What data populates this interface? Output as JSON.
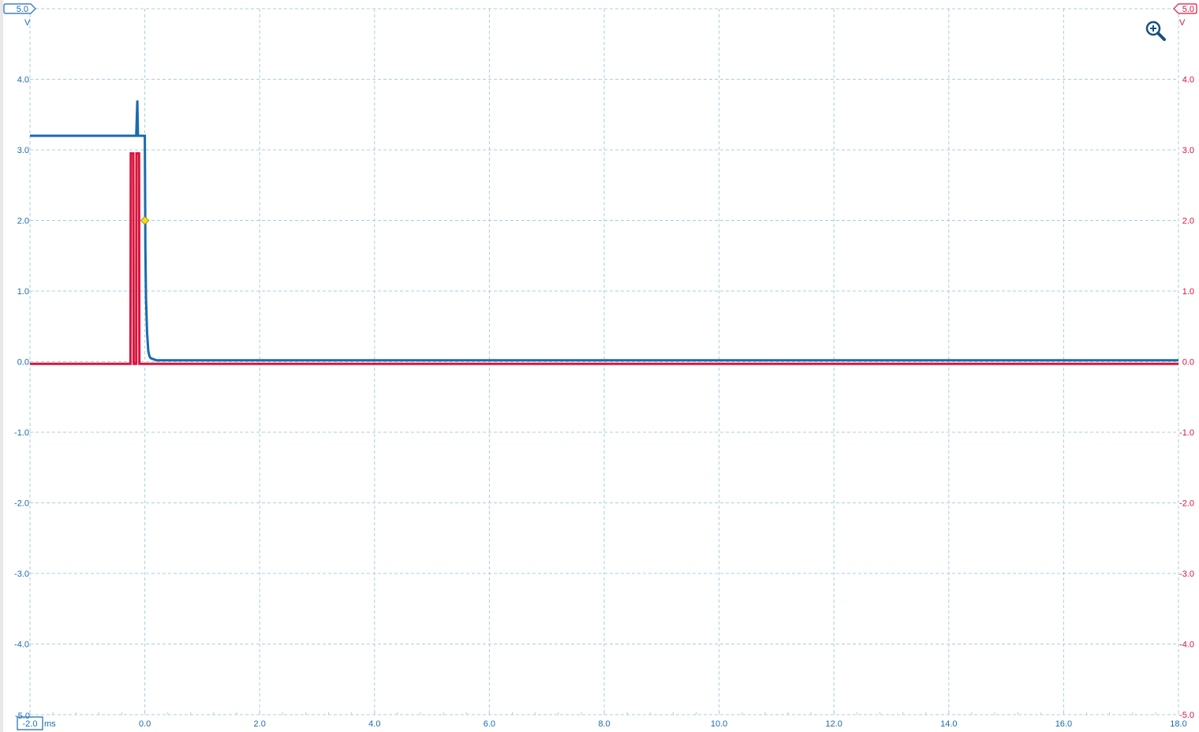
{
  "chart_data": {
    "type": "line",
    "title": "",
    "xlabel": "ms",
    "x_unit": "ms",
    "xlim": [
      -2.0,
      18.0
    ],
    "x_ticks": [
      -2.0,
      0.0,
      2.0,
      4.0,
      6.0,
      8.0,
      10.0,
      12.0,
      14.0,
      16.0,
      18.0
    ],
    "x_tick_labels": [
      "-2.0",
      "0.0",
      "2.0",
      "4.0",
      "6.0",
      "8.0",
      "10.0",
      "12.0",
      "14.0",
      "16.0",
      "18.0"
    ],
    "left_axis": {
      "unit": "V",
      "ylim": [
        -5.0,
        5.0
      ],
      "ticks": [
        5.0,
        4.0,
        3.0,
        2.0,
        1.0,
        0.0,
        -1.0,
        -2.0,
        -3.0,
        -4.0,
        -5.0
      ],
      "tick_labels": [
        "5.0",
        "4.0",
        "3.0",
        "2.0",
        "1.0",
        "0.0",
        "-1.0",
        "-2.0",
        "-3.0",
        "-4.0",
        "-5.0"
      ],
      "color": "#1a6bad"
    },
    "right_axis": {
      "unit": "V",
      "ylim": [
        -5.0,
        5.0
      ],
      "ticks": [
        5.0,
        4.0,
        3.0,
        2.0,
        1.0,
        0.0,
        -1.0,
        -2.0,
        -3.0,
        -4.0,
        -5.0
      ],
      "tick_labels": [
        "5.0",
        "4.0",
        "3.0",
        "2.0",
        "1.0",
        "0.0",
        "-1.0",
        "-2.0",
        "-3.0",
        "-4.0",
        "-5.0"
      ],
      "color": "#d9153e"
    },
    "grid": true,
    "trigger": {
      "x": 0.0,
      "y": 2.0,
      "color": "#f5dd1c"
    },
    "series": [
      {
        "axis": "left",
        "color": "#1a6bad",
        "x": [
          -2.0,
          -0.15,
          -0.13,
          -0.12,
          -0.02,
          0.0,
          0.01,
          0.02,
          0.04,
          0.06,
          0.08,
          0.1,
          0.2,
          18.0
        ],
        "y": [
          3.2,
          3.2,
          3.7,
          3.2,
          3.2,
          3.2,
          1.6,
          0.9,
          0.4,
          0.15,
          0.08,
          0.05,
          0.02,
          0.02
        ]
      },
      {
        "axis": "right",
        "color": "#d9153e",
        "x": [
          -2.0,
          -0.25,
          -0.245,
          -0.2,
          -0.195,
          -0.15,
          -0.145,
          -0.1,
          -0.095,
          0.0,
          0.005,
          18.0
        ],
        "y": [
          -0.03,
          -0.03,
          2.95,
          2.95,
          -0.03,
          -0.03,
          2.95,
          2.95,
          -0.03,
          -0.03,
          -0.03,
          -0.03
        ]
      }
    ]
  },
  "left_top_label": "5.0",
  "right_top_label": "5.0",
  "left_unit": "V",
  "right_unit": "V",
  "x_start_label": "-2.0",
  "x_unit_label": "ms",
  "left_bottom_label": "-5.0",
  "zoom_icon": "zoom-in-icon",
  "colors": {
    "grid": "#a9cfe0",
    "channel_a": "#1a6bad",
    "channel_b": "#d9153e",
    "trigger": "#f5dd1c"
  }
}
